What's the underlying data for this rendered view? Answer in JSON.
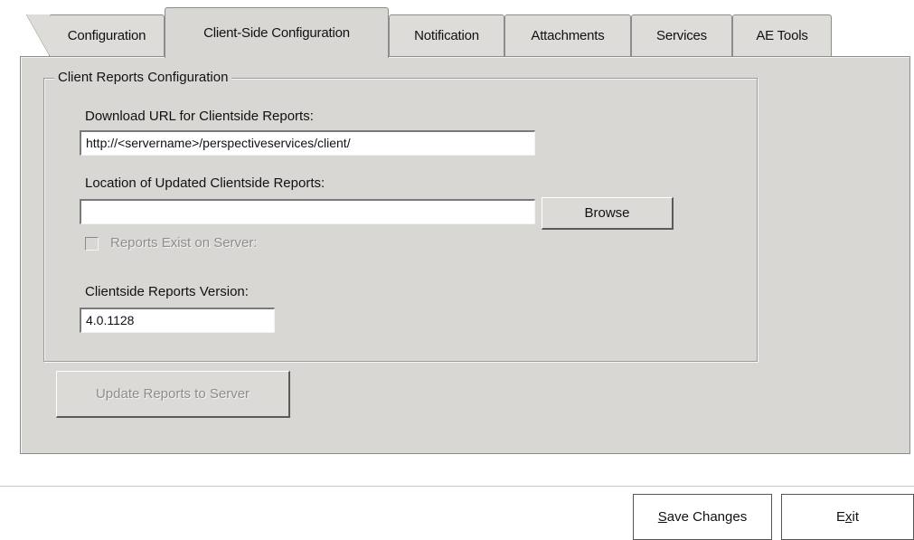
{
  "tabs": [
    {
      "label": "Configuration",
      "active": false
    },
    {
      "label": "Client-Side Configuration",
      "active": true
    },
    {
      "label": "Notification",
      "active": false
    },
    {
      "label": "Attachments",
      "active": false
    },
    {
      "label": "Services",
      "active": false
    },
    {
      "label": "AE Tools",
      "active": false
    }
  ],
  "group": {
    "legend": "Client Reports Configuration",
    "download_url_label": "Download URL for Clientside Reports:",
    "download_url_value": "http://<servername>/perspectiveservices/client/",
    "location_label": "Location of Updated Clientside Reports:",
    "location_value": "",
    "browse_label": "Browse",
    "reports_exist_label": "Reports Exist on Server:",
    "reports_exist_checked": false,
    "version_label": "Clientside Reports Version:",
    "version_value": "4.0.1128"
  },
  "update_button_label": "Update Reports to Server",
  "footer": {
    "save_prefix": "S",
    "save_rest": "ave Changes",
    "exit_prefix": "E",
    "exit_mnemonic": "x",
    "exit_rest": "it"
  }
}
